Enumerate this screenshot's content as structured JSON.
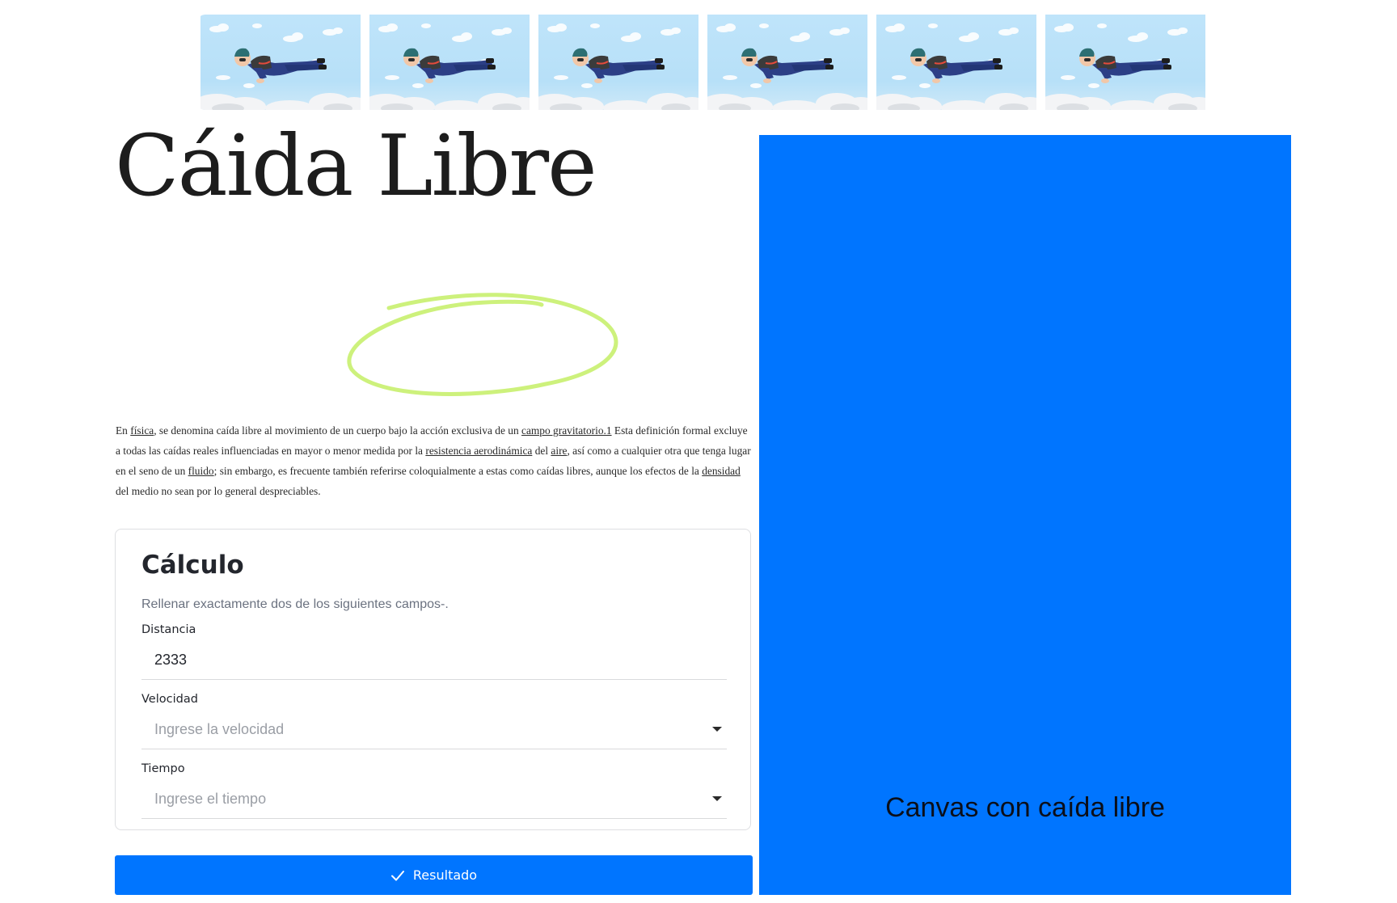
{
  "strip": {
    "tiles": 6,
    "icon": "skydiver-illustration"
  },
  "header": {
    "title": "Cáida Libre"
  },
  "intro": {
    "t1": "En ",
    "l1": "física",
    "t2": ", se denomina caída libre al movimiento de un cuerpo bajo la acción exclusiva de un ",
    "l2": "campo gravitatorio",
    "l3": ".1",
    "t3": " Esta definición formal excluye a todas las caídas reales influenciadas en mayor o menor medida por la ",
    "l4": "resistencia aerodinámica",
    "t4": " del ",
    "l5": "aire",
    "t5": ", así como a cualquier otra que tenga lugar en el seno de un ",
    "l6": "fluido",
    "t6": "; sin embargo, es frecuente también referirse coloquialmente a estas como caídas libres, aunque los efectos de la ",
    "l7": "densidad",
    "t7": " del medio no sean por lo general despreciables."
  },
  "calc": {
    "title": "Cálculo",
    "hint": "Rellenar exactamente dos de los siguientes campos-.",
    "fields": [
      {
        "label": "Distancia",
        "value": "2333",
        "placeholder": ""
      },
      {
        "label": "Velocidad",
        "value": "",
        "placeholder": "Ingrese la velocidad"
      },
      {
        "label": "Tiempo",
        "value": "",
        "placeholder": "Ingrese el tiempo"
      }
    ],
    "submit_label": "Resultado",
    "submit_icon": "check-icon"
  },
  "canvas": {
    "label": "Canvas con caída libre",
    "background": "#0075ff"
  },
  "colors": {
    "accent": "#0075ff",
    "scribble": "#cdf17c"
  }
}
